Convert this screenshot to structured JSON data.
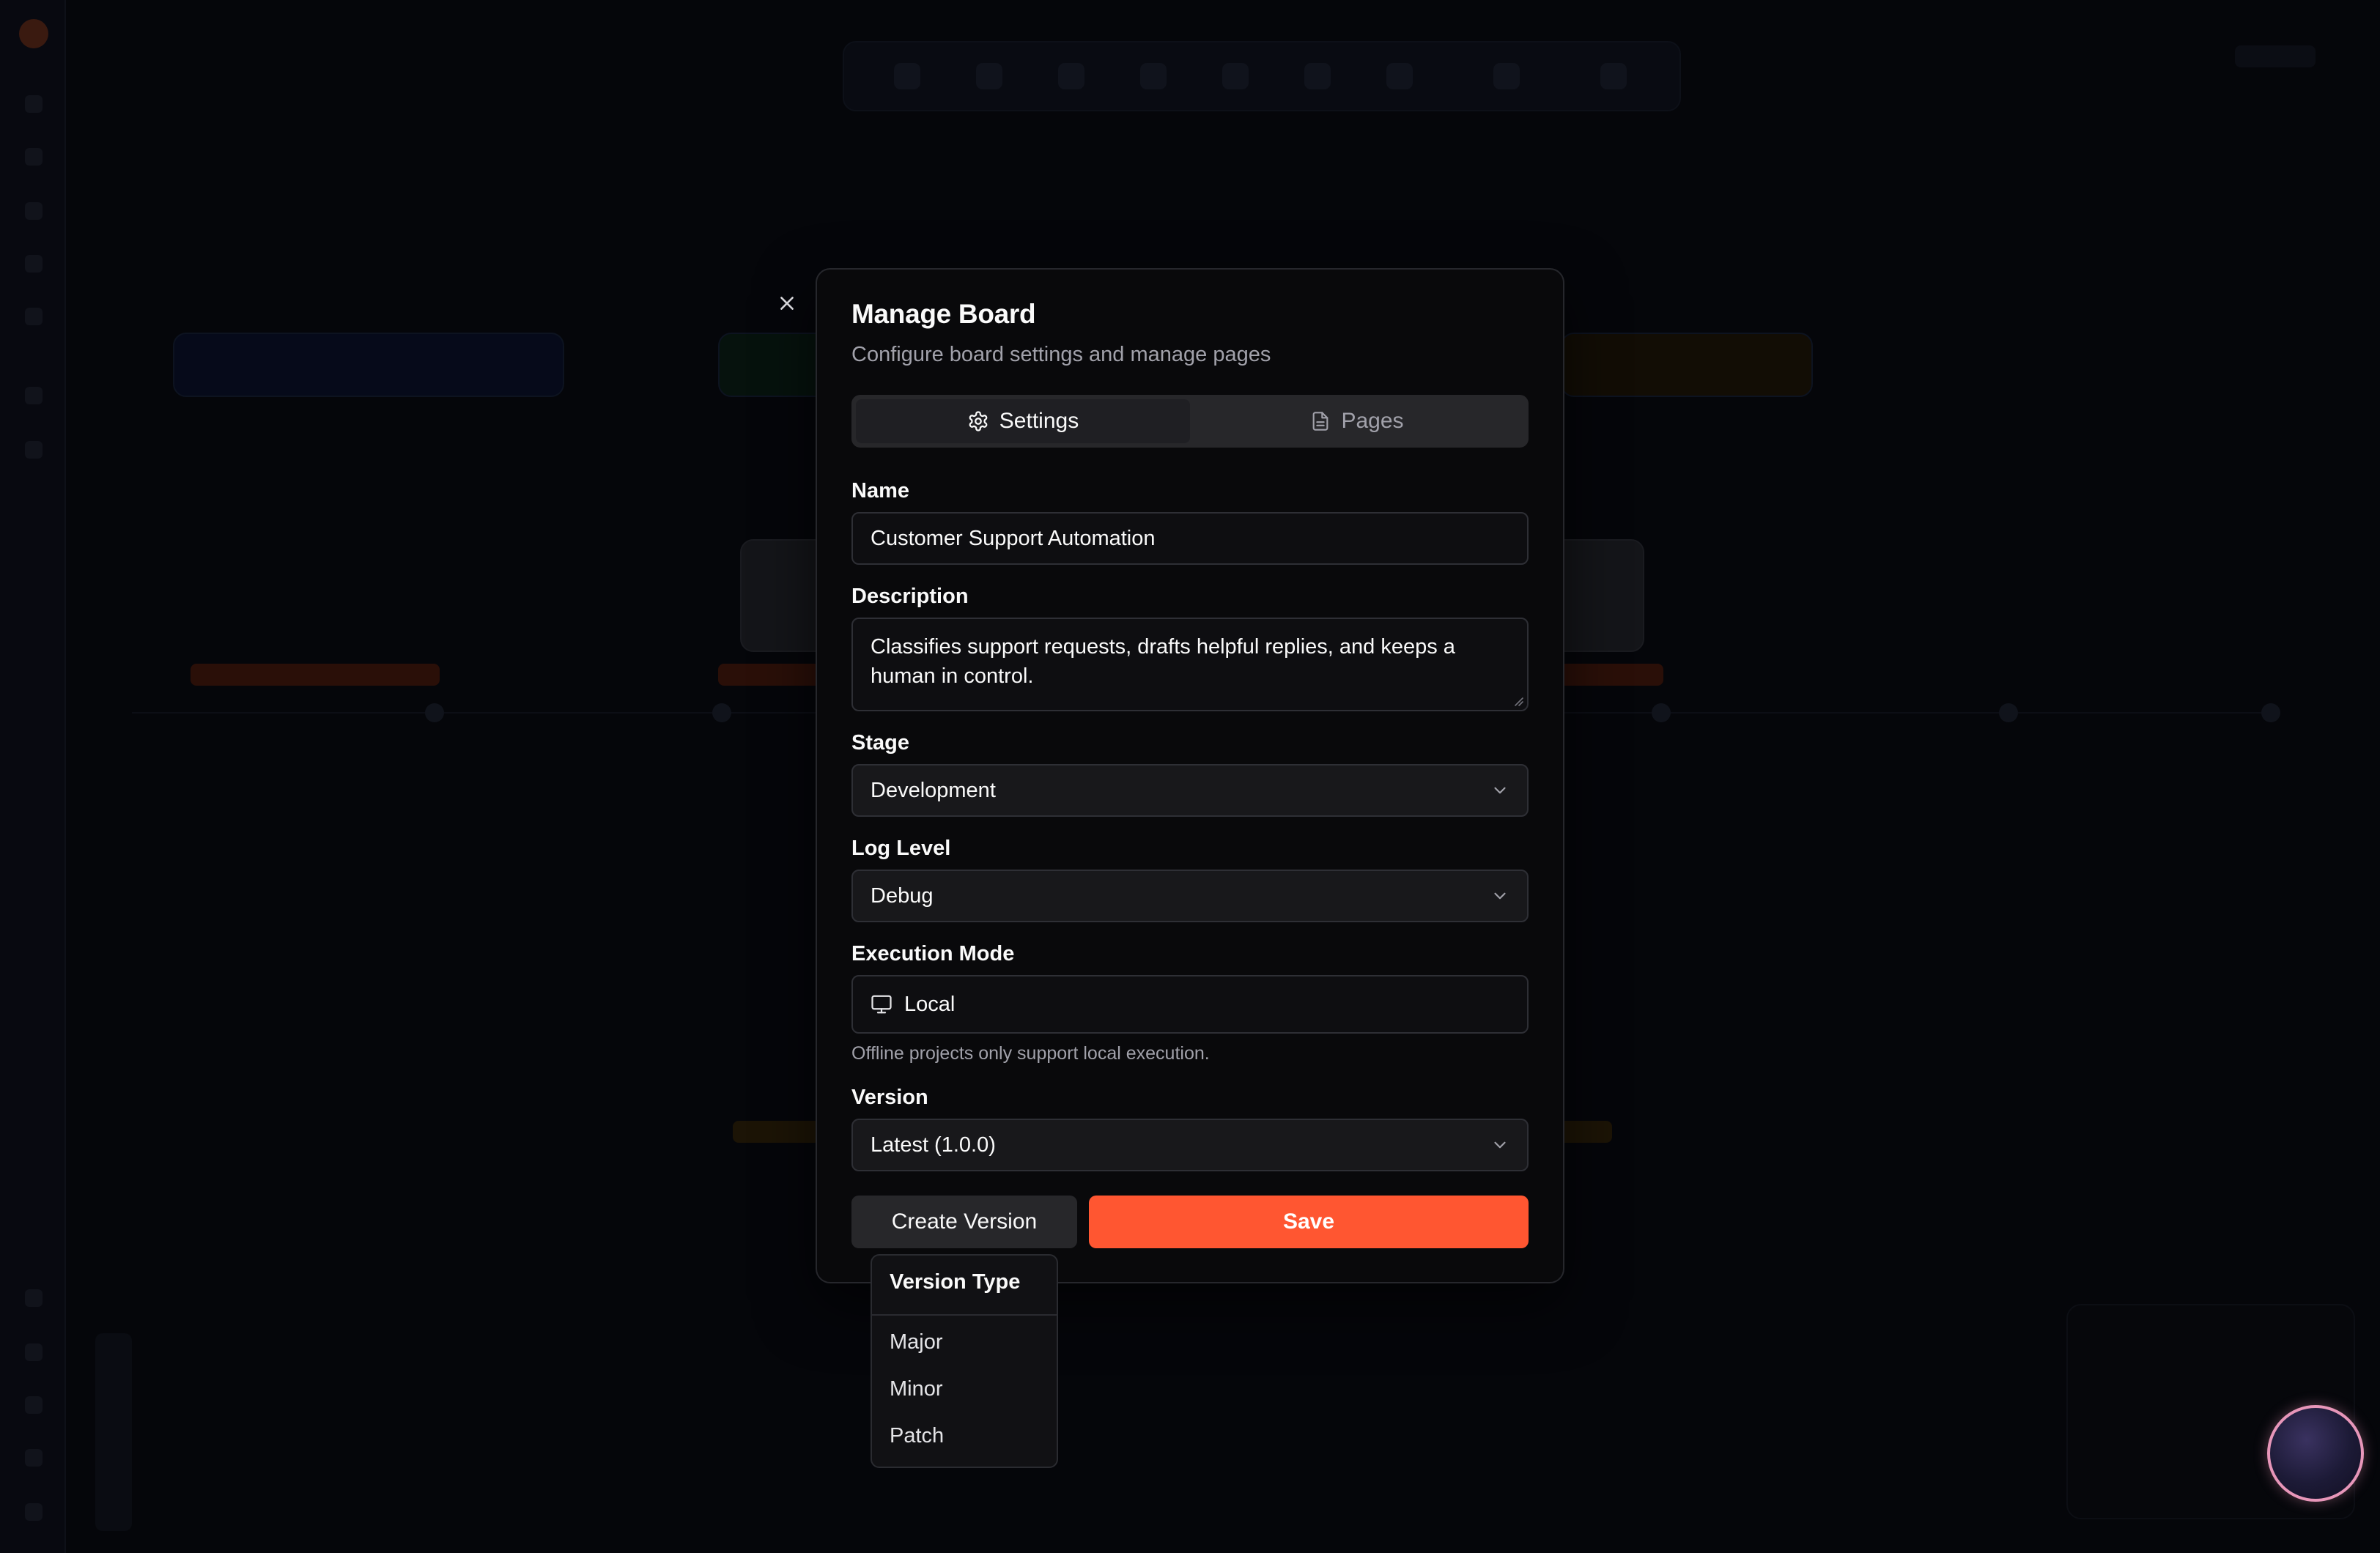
{
  "dialog": {
    "title": "Manage Board",
    "subtitle": "Configure board settings and manage pages",
    "tabs": [
      {
        "label": "Settings",
        "icon": "gear-icon",
        "active": true
      },
      {
        "label": "Pages",
        "icon": "document-icon",
        "active": false
      }
    ],
    "name": {
      "label": "Name",
      "value": "Customer Support Automation"
    },
    "description": {
      "label": "Description",
      "value": "Classifies support requests, drafts helpful replies, and keeps a human in control."
    },
    "stage": {
      "label": "Stage",
      "value": "Development"
    },
    "log_level": {
      "label": "Log Level",
      "value": "Debug"
    },
    "execution_mode": {
      "label": "Execution Mode",
      "value": "Local",
      "icon": "monitor-icon",
      "helper": "Offline projects only support local execution."
    },
    "version": {
      "label": "Version",
      "value": "Latest (1.0.0)"
    },
    "buttons": {
      "create_version": "Create Version",
      "save": "Save"
    }
  },
  "version_menu": {
    "title": "Version Type",
    "items": [
      "Major",
      "Minor",
      "Patch"
    ]
  },
  "colors": {
    "accent": "#ff5631",
    "background": "#05060a",
    "dialog_background": "#09090b",
    "orb_border": "#e796b9"
  }
}
